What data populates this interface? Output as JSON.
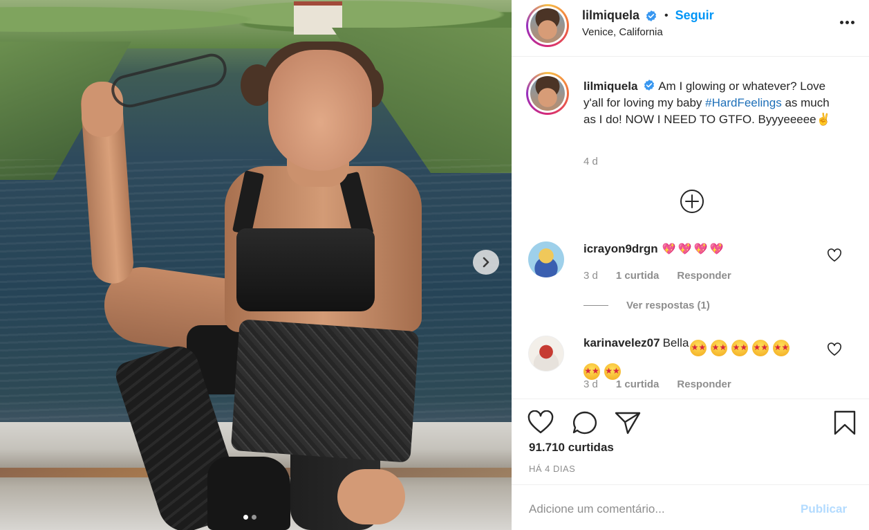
{
  "post": {
    "username": "lilmiquela",
    "follow_label": "Seguir",
    "location": "Venice, California",
    "bullet": "•"
  },
  "caption": {
    "username": "lilmiquela",
    "text_before": "Am I glowing or whatever? Love y'all for loving my baby ",
    "hashtag": "#HardFeelings",
    "text_after": " as much as I do! NOW I NEED TO GTFO. Byyyeeeee",
    "emoji": "✌",
    "time": "4 d"
  },
  "comments": [
    {
      "username": "icrayon9drgn",
      "text": "",
      "emoji": "💖💖💖💖",
      "time": "3 d",
      "likes": "1 curtida",
      "reply": "Responder",
      "view_replies": "Ver respostas (1)"
    },
    {
      "username": "karinavelez07",
      "text": "Bella",
      "emoji_count": 7,
      "time": "3 d",
      "likes": "1 curtida",
      "reply": "Responder"
    }
  ],
  "actions": {
    "likes_count": "91.710 curtidas",
    "time_ago": "HÁ 4 DIAS"
  },
  "comment_box": {
    "placeholder": "Adicione um comentário...",
    "publish_label": "Publicar"
  },
  "carousel": {
    "slide_count": 2,
    "active_index": 0
  },
  "icons": [
    "verified-badge-icon",
    "more-options-icon",
    "plus-circle-icon",
    "heart-icon",
    "comment-icon",
    "share-icon",
    "bookmark-icon",
    "chevron-right-icon"
  ],
  "colors": {
    "accent": "#0095f6",
    "hashtag": "#1d6fb8",
    "text": "#262626",
    "muted": "#8e8e8e",
    "publish_disabled": "#b3dbff"
  }
}
